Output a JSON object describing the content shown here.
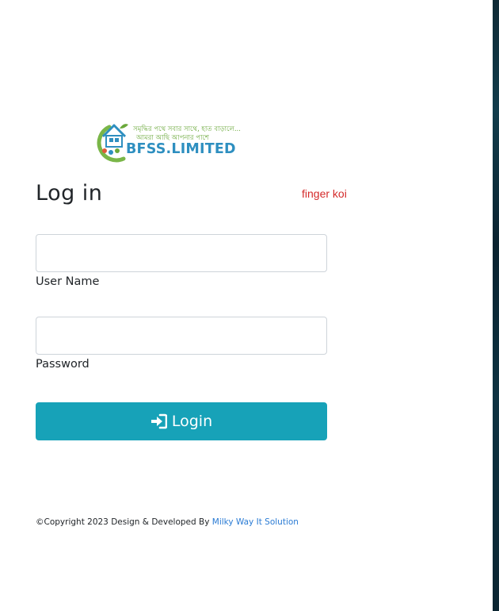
{
  "logo": {
    "tagline_line1": "সমৃদ্ধির পথে সবার সাথে, হাত বাড়ালে...",
    "tagline_line2": "আমরা আছি আপনার পাশে",
    "brand_text": "BFSS.LIMITED",
    "colors": {
      "brand_blue": "#2e8fc0",
      "brand_green": "#6aa83a"
    }
  },
  "header": {
    "title": "Log in",
    "finger_link": "finger koi"
  },
  "form": {
    "username": {
      "label": "User Name",
      "value": "",
      "placeholder": ""
    },
    "password": {
      "label": "Password",
      "value": "",
      "placeholder": ""
    },
    "login_button": {
      "label": "Login",
      "icon": "sign-in-icon"
    }
  },
  "footer": {
    "copyright_text": "©Copyright 2023 Design & Developed By ",
    "developer_link": "Milky Way It Solution"
  },
  "colors": {
    "accent": "#17a2b8",
    "link": "#2a7bd4",
    "finger_link": "#d42a2a",
    "text": "#212529",
    "input_border": "#ced4da"
  }
}
